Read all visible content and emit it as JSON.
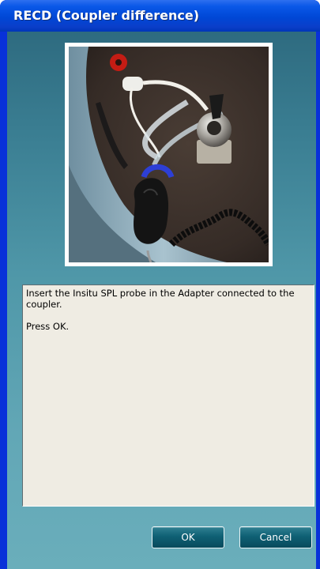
{
  "window": {
    "title": "RECD (Coupler difference)"
  },
  "image": {
    "icon": "insitu-spl-probe-adapter-photo"
  },
  "message": {
    "line1": "Insert the Insitu SPL probe in the Adapter connected to the",
    "line2": "coupler.",
    "line3": "Press OK."
  },
  "buttons": {
    "ok_label": "OK",
    "cancel_label": "Cancel"
  },
  "colors": {
    "title_bar": "#0a58e8",
    "client_top": "#2e6b80",
    "client_bottom": "#6aaebb",
    "message_bg": "#efece3",
    "button_bg": "#0f6074"
  }
}
